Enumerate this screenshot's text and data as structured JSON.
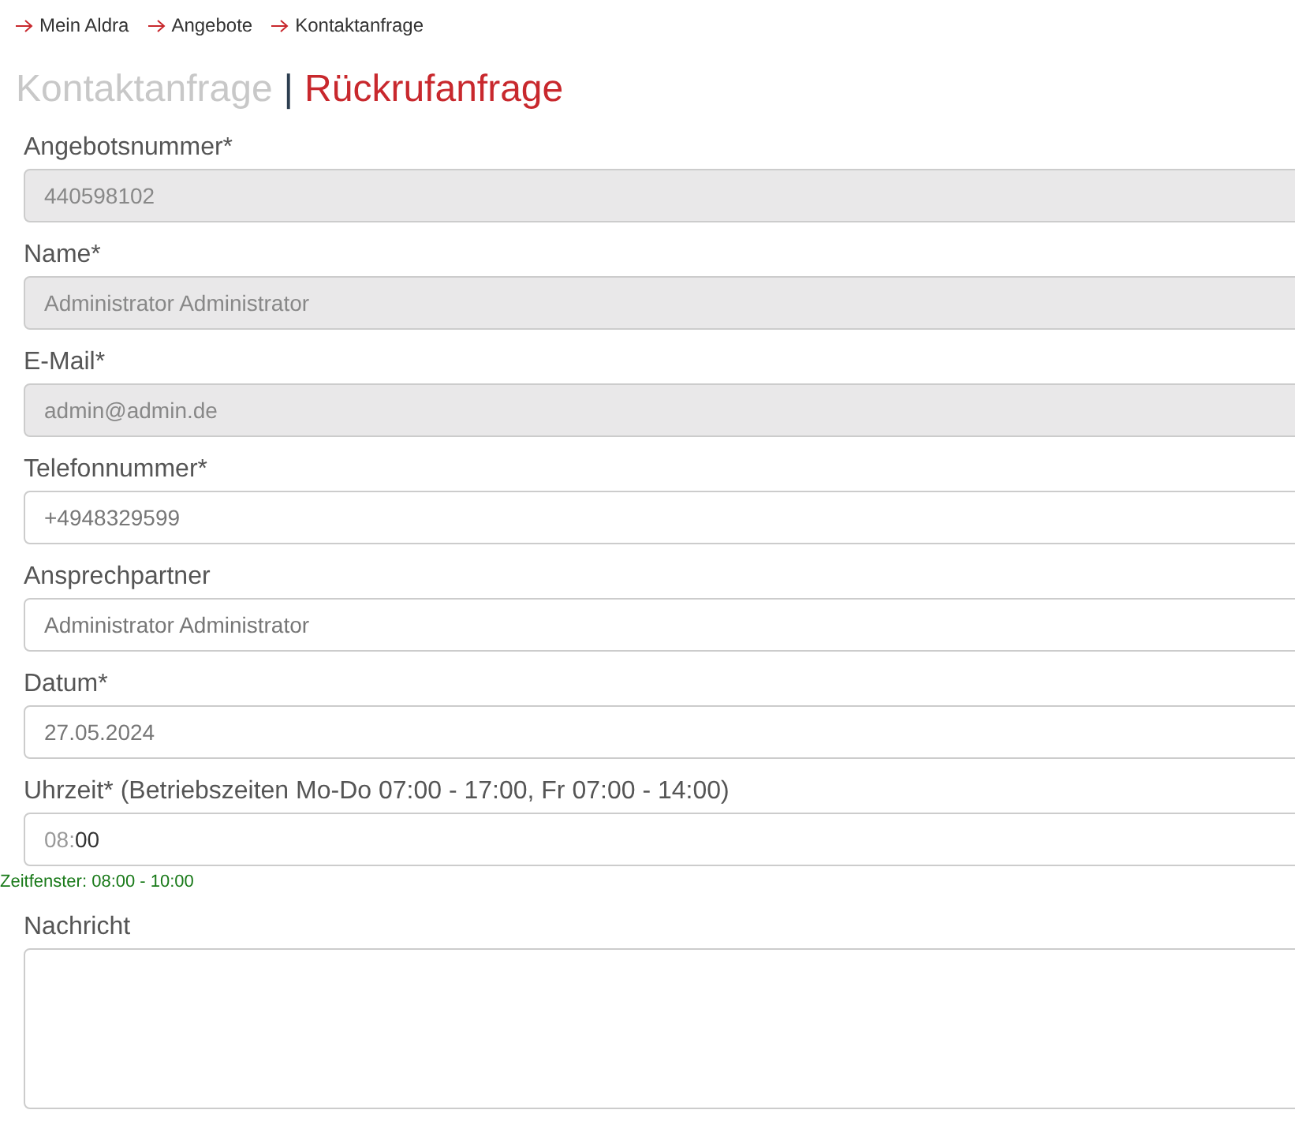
{
  "breadcrumb": [
    {
      "label": "Mein Aldra"
    },
    {
      "label": "Angebote"
    },
    {
      "label": "Kontaktanfrage"
    }
  ],
  "heading": {
    "separator": "|",
    "tabs": [
      {
        "label": "Kontaktanfrage",
        "selected": false
      },
      {
        "label": "Rückrufanfrage",
        "selected": true
      }
    ]
  },
  "form": {
    "fields": [
      {
        "kind": "text",
        "label": "Angebotsnummer*",
        "value": "440598102",
        "disabled": true
      },
      {
        "kind": "text",
        "label": "Name*",
        "value": "Administrator Administrator",
        "disabled": true
      },
      {
        "kind": "text",
        "label": "E-Mail*",
        "value": "admin@admin.de",
        "disabled": true
      },
      {
        "kind": "text",
        "label": "Telefonnummer*",
        "value": "+4948329599",
        "disabled": false
      },
      {
        "kind": "text",
        "label": "Ansprechpartner",
        "value": "Administrator Administrator",
        "disabled": false
      },
      {
        "kind": "text",
        "label": "Datum*",
        "value": "27.05.2024",
        "disabled": false
      },
      {
        "kind": "time",
        "label": "Uhrzeit* (Betriebszeiten Mo-Do 07:00 - 17:00, Fr 07:00 - 14:00)",
        "separator": ":",
        "segments": [
          {
            "text": "08",
            "selected": false
          },
          {
            "text": "00",
            "selected": true
          }
        ],
        "hint": "Zeitfenster: 08:00 - 10:00",
        "disabled": false
      },
      {
        "kind": "textarea",
        "label": "Nachricht",
        "disabled": false
      }
    ]
  }
}
